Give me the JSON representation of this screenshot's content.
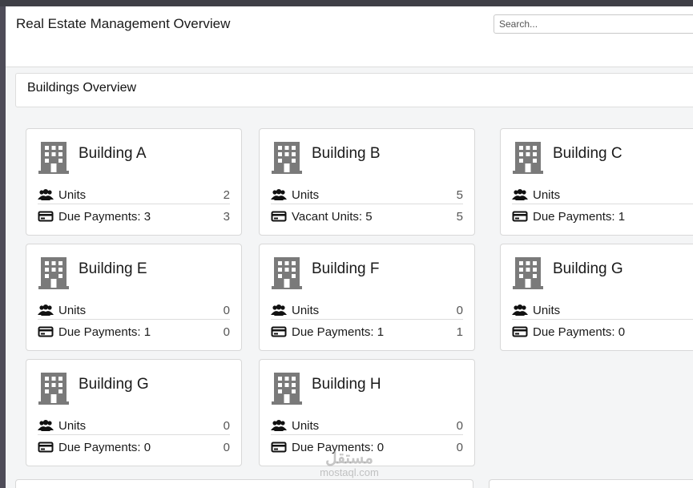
{
  "app": {
    "title": "Real Estate Management Overview"
  },
  "search": {
    "placeholder": "Search..."
  },
  "section": {
    "title": "Buildings Overview"
  },
  "cards": [
    {
      "name": "Building A",
      "row1": {
        "label": "Units",
        "value": "2"
      },
      "row2": {
        "label": "Due Payments: 3",
        "value": "3"
      }
    },
    {
      "name": "Building B",
      "row1": {
        "label": "Units",
        "value": "5"
      },
      "row2": {
        "label": "Vacant Units: 5",
        "value": "5"
      }
    },
    {
      "name": "Building C",
      "row1": {
        "label": "Units",
        "value": ""
      },
      "row2": {
        "label": "Due Payments: 1",
        "value": ""
      }
    },
    {
      "name": "Building E",
      "row1": {
        "label": "Units",
        "value": "0"
      },
      "row2": {
        "label": "Due Payments: 1",
        "value": "0"
      }
    },
    {
      "name": "Building F",
      "row1": {
        "label": "Units",
        "value": "0"
      },
      "row2": {
        "label": "Due Payments: 1",
        "value": "1"
      }
    },
    {
      "name": "Building G",
      "row1": {
        "label": "Units",
        "value": ""
      },
      "row2": {
        "label": "Due Payments: 0",
        "value": ""
      }
    },
    {
      "name": "Building G",
      "row1": {
        "label": "Units",
        "value": "0"
      },
      "row2": {
        "label": "Due Payments: 0",
        "value": "0"
      }
    },
    {
      "name": "Building H",
      "row1": {
        "label": "Units",
        "value": "0"
      },
      "row2": {
        "label": "Due Payments: 0",
        "value": "0"
      }
    }
  ],
  "icons": {
    "building": "building-icon",
    "units": "users-icon",
    "payments": "payment-card-icon"
  },
  "watermark": {
    "arabic": "مستقل",
    "latin": "mostaql.com"
  },
  "colors": {
    "icon": "#777777",
    "border": "#d8d8d8",
    "background": "#f4f5f6"
  }
}
